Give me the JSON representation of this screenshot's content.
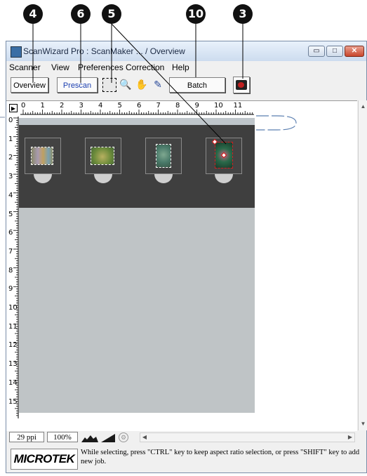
{
  "callouts": [
    "4",
    "6",
    "5",
    "10",
    "3"
  ],
  "window": {
    "title": "ScanWizard Pro : ScanMaker ... / Overview",
    "min_glyph": "▭",
    "max_glyph": "□",
    "close_glyph": "✕"
  },
  "menu": [
    "Scanner",
    "View",
    "Preferences",
    "Correction",
    "Help"
  ],
  "toolbar": {
    "overview_label": "Overview",
    "prescan_label": "Prescan",
    "batch_label": "Batch",
    "tools": [
      "select-icon",
      "zoom-icon",
      "hand-icon",
      "eyedropper-icon"
    ],
    "job_icon": "scan-job-icon"
  },
  "ruler": {
    "top_numbers": [
      "0",
      "1",
      "2",
      "3",
      "4",
      "5",
      "6",
      "7",
      "8",
      "9",
      "10",
      "11"
    ],
    "left_numbers": [
      "0",
      "1",
      "2",
      "3",
      "4",
      "5",
      "6",
      "7",
      "8",
      "9",
      "10",
      "11",
      "12",
      "13",
      "14",
      "15"
    ]
  },
  "status": {
    "resolution": "29 ppi",
    "zoom": "100%"
  },
  "footer": {
    "logo": "MICROTEK",
    "tip": "While selecting, press \"CTRL\" key to keep aspect ratio selection, or press \"SHIFT\" key to add new job."
  },
  "colors": {
    "tray": "#3f3f3f",
    "bed": "#bfc4c6",
    "active_selection": "#d02020",
    "prescan_text": "#1b3fb0"
  }
}
